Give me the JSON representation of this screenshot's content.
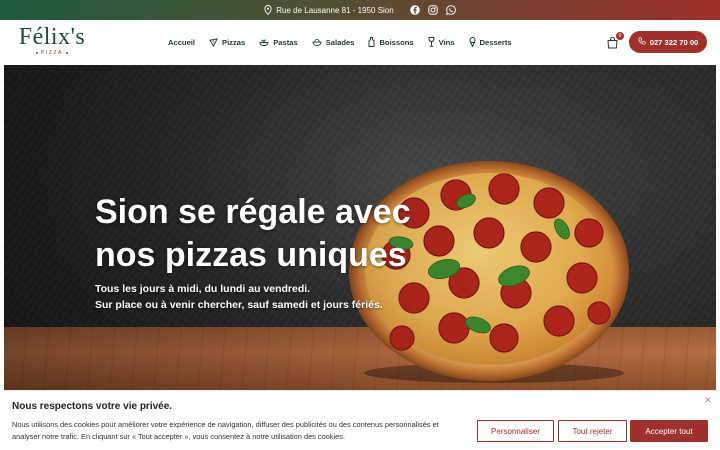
{
  "topbar": {
    "address": "Rue de Lausanne 81 - 1950 Sion",
    "icons": [
      "location-pin-icon",
      "facebook-icon",
      "instagram-icon",
      "whatsapp-icon"
    ]
  },
  "logo": {
    "word": "Félix's",
    "sub": "PIZZA"
  },
  "nav": {
    "items": [
      {
        "label": "Accueil",
        "icon": ""
      },
      {
        "label": "Pizzas",
        "icon": "pizza-slice-icon"
      },
      {
        "label": "Pastas",
        "icon": "pasta-icon"
      },
      {
        "label": "Salades",
        "icon": "salad-bowl-icon"
      },
      {
        "label": "Boissons",
        "icon": "bottle-icon"
      },
      {
        "label": "Vins",
        "icon": "wine-glass-icon"
      },
      {
        "label": "Desserts",
        "icon": "ice-cream-icon"
      }
    ]
  },
  "cart": {
    "count": "0",
    "icon": "shopping-bag-icon"
  },
  "phone": {
    "label": "027 322 70 00",
    "icon": "phone-icon"
  },
  "hero": {
    "title_line1": "Sion se régale avec",
    "title_line2": "nos pizzas uniques",
    "sub_line1": "Tous les jours à midi, du lundi au vendredi.",
    "sub_line2": "Sur place ou à venir chercher, sauf samedi et jours fériés."
  },
  "cookie": {
    "title": "Nous respectons votre vie privée.",
    "text": "Nous utilisons des cookies pour améliorer votre expérience de navigation, diffuser des publicités ou des contenus personnalisés et analyser notre trafic. En cliquant sur « Tout accepter », vous consentez à notre utilisation des cookies.",
    "customize_label": "Personnaliser",
    "reject_label": "Tout rejeter",
    "accept_label": "Accepter tout",
    "close_icon": "close-icon"
  },
  "colors": {
    "brand_red": "#a0302b",
    "brand_green": "#1b4d35"
  }
}
